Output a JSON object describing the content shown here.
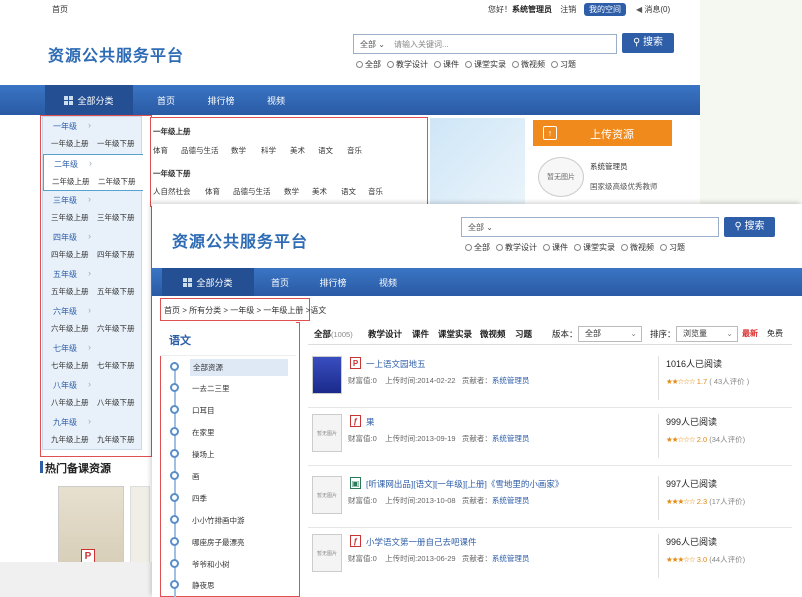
{
  "back": {
    "topbar": {
      "home": "首页",
      "greeting": "您好！",
      "user": "系统管理员",
      "logout": "注销",
      "my_space": "我的空间",
      "messages": "消息(0)"
    },
    "logo": "资源公共服务平台",
    "search": {
      "scope": "全部",
      "placeholder": "请输入关键词...",
      "button": "搜索"
    },
    "filters": [
      "全部",
      "教学设计",
      "课件",
      "课堂实录",
      "微视频",
      "习题"
    ],
    "nav": {
      "category": "全部分类",
      "items": [
        "首页",
        "排行榜",
        "视频"
      ]
    },
    "grades": [
      {
        "name": "一年级",
        "up": "一年级上册",
        "down": "一年级下册"
      },
      {
        "name": "二年级",
        "up": "二年级上册",
        "down": "二年级下册"
      },
      {
        "name": "三年级",
        "up": "三年级上册",
        "down": "三年级下册"
      },
      {
        "name": "四年级",
        "up": "四年级上册",
        "down": "四年级下册"
      },
      {
        "name": "五年级",
        "up": "五年级上册",
        "down": "五年级下册"
      },
      {
        "name": "六年级",
        "up": "六年级上册",
        "down": "六年级下册"
      },
      {
        "name": "七年级",
        "up": "七年级上册",
        "down": "七年级下册"
      },
      {
        "name": "八年级",
        "up": "八年级上册",
        "down": "八年级下册"
      },
      {
        "name": "九年级",
        "up": "九年级上册",
        "down": "九年级下册"
      }
    ],
    "subpanel": {
      "up_title": "一年级上册",
      "up_subjects": [
        "体育",
        "品德与生活",
        "数学",
        "科学",
        "美术",
        "语文",
        "音乐"
      ],
      "down_title": "一年级下册",
      "down_subjects": [
        "人自然社会",
        "体育",
        "品德与生活",
        "数学",
        "美术",
        "语文",
        "音乐"
      ]
    },
    "upload": "上传资源",
    "profile": {
      "name": "系统管理员",
      "desc": "国家级高级优秀教师",
      "avatar_text": "暂无图片"
    },
    "hot_title": "热门备课资源"
  },
  "front": {
    "logo": "资源公共服务平台",
    "search": {
      "scope": "全部",
      "button": "搜索"
    },
    "filters": [
      "全部",
      "教学设计",
      "课件",
      "课堂实录",
      "微视频",
      "习题"
    ],
    "nav": {
      "category": "全部分类",
      "items": [
        "首页",
        "排行榜",
        "视频"
      ]
    },
    "breadcrumb": [
      "首页",
      "所有分类",
      "一年级",
      "一年级上册",
      "语文"
    ],
    "sidebar": {
      "title": "语文",
      "items": [
        "全部资源",
        "一去二三里",
        "口耳目",
        "在家里",
        "操场上",
        "画",
        "四季",
        "小小竹排画中游",
        "哪座房子最漂亮",
        "爷爷和小树",
        "静夜思"
      ]
    },
    "tabs": {
      "all": "全部",
      "all_count": "(1005)",
      "items": [
        "教学设计",
        "课件",
        "课堂实录",
        "微视频",
        "习题"
      ]
    },
    "version_label": "版本：",
    "version_value": "全部",
    "sort_label": "排序：",
    "sort_value": "浏览量",
    "sort_new": "最新",
    "sort_free": "免费",
    "results": [
      {
        "title": "一上语文园地五",
        "money": "财富值:0",
        "date": "上传时间:2014-02-22",
        "author_label": "贡献者：",
        "author": "系统管理员",
        "reads": "1016人已阅读",
        "stars": "★★☆☆☆",
        "score": "1.7",
        "reviews": "( 43人评价 )",
        "icon": "P",
        "thumb": ""
      },
      {
        "title": "果",
        "money": "财富值:0",
        "date": "上传时间:2013-09-19",
        "author_label": "贡献者：",
        "author": "系统管理员",
        "reads": "999人已阅读",
        "stars": "★★☆☆☆",
        "score": "2.0",
        "reviews": "(34人评价)",
        "icon": "ƒ",
        "thumb": "暂无图片"
      },
      {
        "title": "[听课网出品][语文][一年级][上册]《雪地里的小画家》",
        "money": "财富值:0",
        "date": "上传时间:2013-10-08",
        "author_label": "贡献者：",
        "author": "系统管理员",
        "reads": "997人已阅读",
        "stars": "★★★☆☆",
        "score": "2.3",
        "reviews": "(17人评价)",
        "icon": "▣",
        "thumb": "暂无图片"
      },
      {
        "title": "小学语文第一册自己去吧课件",
        "money": "财富值:0",
        "date": "上传时间:2013-06-29",
        "author_label": "贡献者：",
        "author": "系统管理员",
        "reads": "996人已阅读",
        "stars": "★★★☆☆",
        "score": "3.0",
        "reviews": "(44人评价)",
        "icon": "ƒ",
        "thumb": "暂无图片"
      }
    ]
  }
}
